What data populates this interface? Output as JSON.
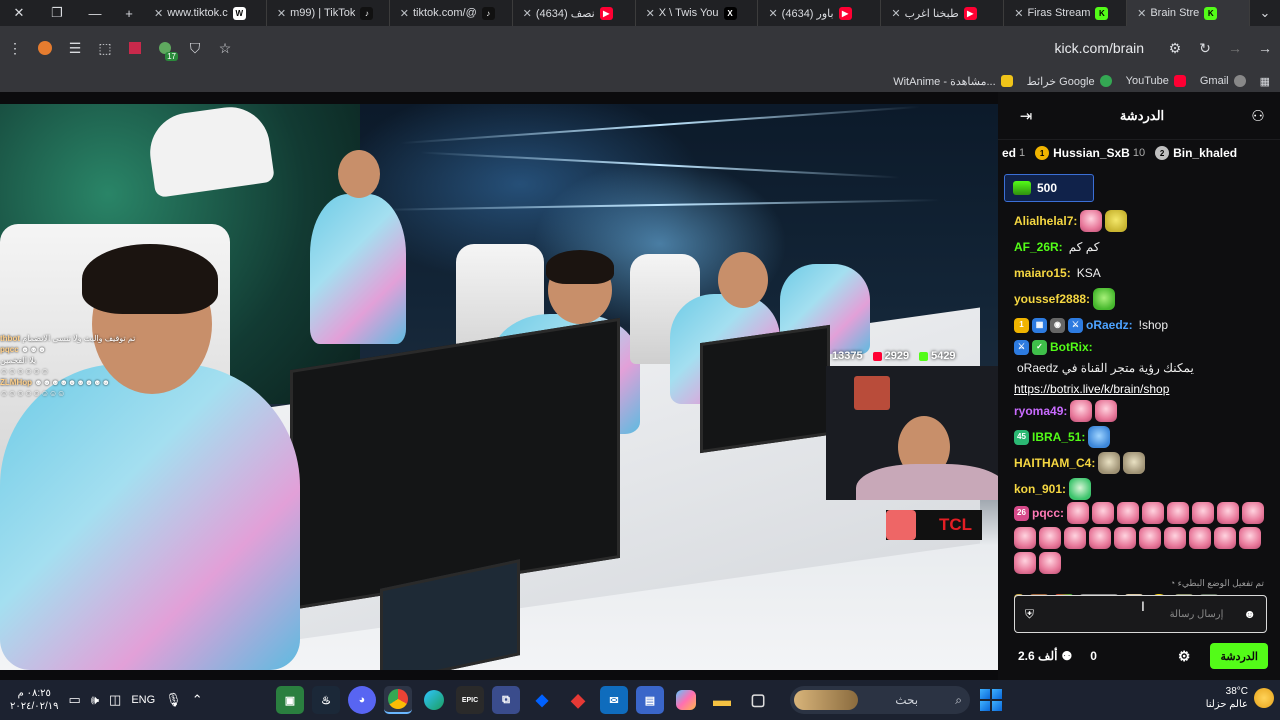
{
  "tabs": [
    {
      "title": "www.tiktok.c",
      "fav_color": "#ffffff",
      "fav_text": "W"
    },
    {
      "title": "m99) | TikTok",
      "fav_color": "#111111",
      "fav_text": "♪"
    },
    {
      "title": "tiktok.com/@",
      "fav_color": "#111111",
      "fav_text": "♪"
    },
    {
      "title": "(4634) نصف",
      "fav_color": "#ff0033",
      "fav_text": "▶"
    },
    {
      "title": "X \\ Twis You",
      "fav_color": "#000000",
      "fav_text": "X"
    },
    {
      "title": "(4634) باور",
      "fav_color": "#ff0033",
      "fav_text": "▶"
    },
    {
      "title": "طبخنا اغرب",
      "fav_color": "#ff0033",
      "fav_text": "▶"
    },
    {
      "title": "Firas Stream",
      "fav_color": "#53fc18",
      "fav_text": "K"
    },
    {
      "title": "Brain Stre",
      "fav_color": "#53fc18",
      "fav_text": "K"
    }
  ],
  "toolbar": {
    "url": "kick.com/brain",
    "ext_badge": "17"
  },
  "bookmarks": [
    {
      "label": "WitAnime - مشاهدة...",
      "color": "#f0c419"
    },
    {
      "label": "خرائط Google",
      "color": "#34a853"
    },
    {
      "label": "YouTube",
      "color": "#ff0033"
    },
    {
      "label": "Gmail",
      "color": "#ea4335"
    }
  ],
  "video": {
    "stats": {
      "viewers": "13375",
      "likes": "2929",
      "kicks": "5429"
    },
    "sponsor": "TCL",
    "overlay_chat": [
      {
        "user": "thbot",
        "text": "تم توقيف والبث ولا تنسى الانضمام"
      },
      {
        "user": "pqcc",
        "text": "☻☻☻"
      },
      {
        "user": "",
        "text": "يلا الفخمين"
      },
      {
        "user": "",
        "text": "☺☺☺☺☺☺"
      },
      {
        "user": "ZLMHop",
        "text": "☻☻☻☻☻☻☻☻☻"
      },
      {
        "user": "",
        "text": "☺☺☺☺☺☺☺☺"
      }
    ]
  },
  "chat": {
    "title": "الدردشة",
    "leaderboard": [
      {
        "name": "ed",
        "rank": "1",
        "medal_color": "",
        "medal_text": ""
      },
      {
        "name": "Hussian_SxB",
        "rank": "10",
        "medal_color": "#f0b400",
        "medal_text": "1"
      },
      {
        "name": "Bin_khaled",
        "rank": "",
        "medal_color": "#bfbfbf",
        "medal_text": "2"
      }
    ],
    "pinned_amount": "500",
    "messages": [
      {
        "user": "Alialhelal7:",
        "color": "#f5d742",
        "text": "",
        "emotes": [
          "em-pink",
          "em-yel"
        ]
      },
      {
        "user": "AF_26R:",
        "color": "#53fc18",
        "text": "كم كم",
        "emotes": []
      },
      {
        "user": "maiaro15:",
        "color": "#f5d742",
        "text": "KSA",
        "emotes": []
      },
      {
        "user": "youssef2888:",
        "color": "#f5d742",
        "text": "",
        "emotes": [
          "em-grn"
        ]
      },
      {
        "user": "oRaedz:",
        "color": "#4da3ff",
        "text": "!shop",
        "emotes": []
      },
      {
        "user": "BotRix:",
        "color": "#53fc18",
        "text": "oRaedz يمكنك رؤية متجر القناة في",
        "emotes": []
      },
      {
        "user": "ryoma49:",
        "color": "#c96bff",
        "text": "",
        "emotes": [
          "em-pink",
          "em-pink"
        ]
      },
      {
        "user": "IBRA_51:",
        "color": "#53fc18",
        "text": "",
        "emotes": [
          "em-blu"
        ]
      },
      {
        "user": "HAITHAM_C4:",
        "color": "#f5d742",
        "text": "",
        "emotes": [
          "em-cat",
          "em-cat"
        ]
      },
      {
        "user": "kon_901:",
        "color": "#f5d742",
        "text": "",
        "emotes": [
          "em-grnface"
        ]
      },
      {
        "user": "pqcc:",
        "color": "#ff7ab6",
        "text": "",
        "emotes": [
          "em-pink",
          "em-pink",
          "em-pink",
          "em-pink",
          "em-pink",
          "em-pink",
          "em-pink",
          "em-pink",
          "em-pink",
          "em-pink",
          "em-pink",
          "em-pink",
          "em-pink",
          "em-pink",
          "em-pink",
          "em-pink",
          "em-pink",
          "em-pink",
          "em-pink",
          "em-pink"
        ]
      }
    ],
    "botrix_link": "https://botrix.live/k/brain/shop",
    "system_notice": "تم تفعيل الوضع البطيء",
    "input_placeholder": "إرسال رسالة",
    "followers": "2.6 ألف",
    "viewers": "0",
    "send_label": "الدردشة"
  },
  "taskbar": {
    "time": "٠٨:٢٥ م",
    "date": "٢٠٢٤/٠٢/١٩",
    "lang": "ENG",
    "search_label": "بحث",
    "temp": "38°C",
    "weather_text": "عالم حزلنا"
  }
}
